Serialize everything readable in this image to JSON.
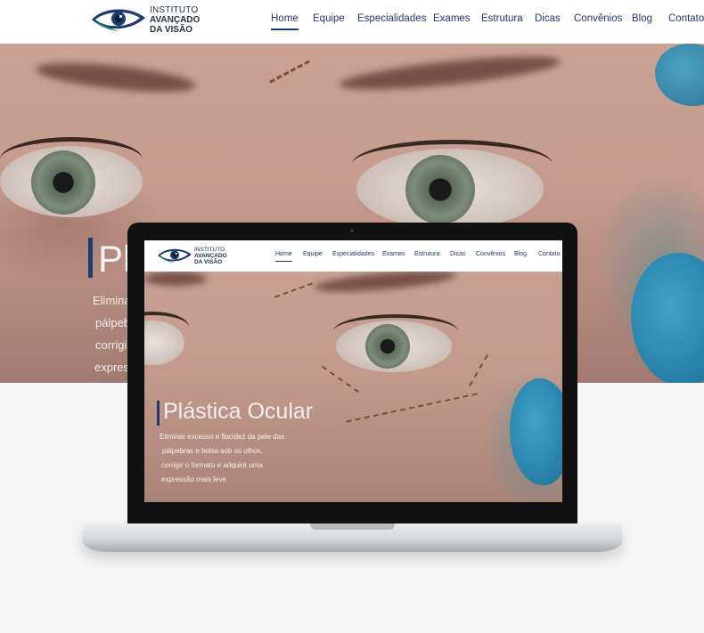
{
  "brand": {
    "line1": "INSTITUTO",
    "line2": "AVANÇADO",
    "line3": "DA VISÃO"
  },
  "nav": {
    "items": [
      {
        "label": "Home",
        "active": true
      },
      {
        "label": "Equipe"
      },
      {
        "label": "Especialidades"
      },
      {
        "label": "Exames"
      },
      {
        "label": "Estrutura"
      },
      {
        "label": "Dicas"
      },
      {
        "label": "Convênios"
      },
      {
        "label": "Blog"
      },
      {
        "label": "Contato"
      }
    ]
  },
  "hero": {
    "title_partial": "Pl",
    "subtitle_partial": [
      "Eliminar",
      "pálpebra",
      "corrigi",
      "expres"
    ]
  },
  "laptop_screen": {
    "title": "Plástica Ocular",
    "subtitle": [
      "Eliminar excesso e flacidez da pele das",
      "pálpebras e bolsa sob os olhos,",
      "corrigir o formato e adquirir uma",
      "expressão mais leve"
    ]
  },
  "colors": {
    "brand_navy": "#1d3b6e",
    "brand_teal": "#1e8c8c",
    "header_bg": "#ffffff",
    "page_bg": "#f5f5f5"
  }
}
